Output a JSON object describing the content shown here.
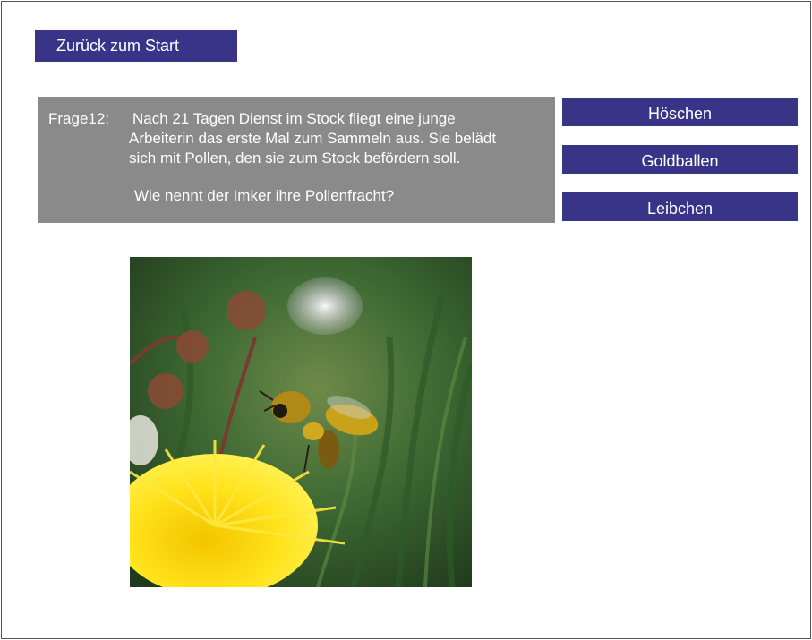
{
  "nav": {
    "back_label": "Zurück zum Start"
  },
  "question": {
    "label": "Frage12:",
    "lines": [
      "Nach 21 Tagen Dienst im Stock fliegt eine junge",
      "Arbeiterin das erste Mal zum Sammeln aus. Sie belädt",
      "sich mit Pollen, den sie zum Stock befördern soll.",
      "Wie nennt der Imker ihre Pollenfracht?"
    ]
  },
  "answers": [
    {
      "label": "Höschen"
    },
    {
      "label": "Goldballen"
    },
    {
      "label": "Leibchen"
    }
  ],
  "colors": {
    "button_bg": "#3a3488",
    "question_bg": "#8a8a8a",
    "text": "#ffffff"
  }
}
